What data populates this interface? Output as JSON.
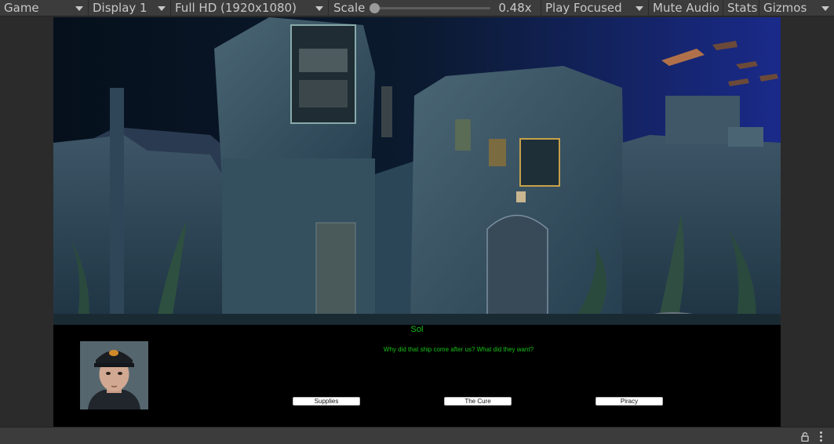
{
  "toolbar": {
    "view_label": "Game",
    "display_label": "Display 1",
    "resolution_label": "Full HD (1920x1080)",
    "scale_label": "Scale",
    "scale_value": "0.48x",
    "scale_fraction": 0.0,
    "play_mode_label": "Play Focused",
    "mute_label": "Mute Audio",
    "stats_label": "Stats",
    "gizmos_label": "Gizmos"
  },
  "dialog": {
    "speaker": "Sol",
    "line": "Why did that ship come after us? What did they want?",
    "choices": [
      "Supplies",
      "The Cure",
      "Piracy"
    ],
    "text_color": "#18c018"
  },
  "icons": {
    "lock": "lock-icon",
    "menu": "kebab-menu-icon",
    "dropdown": "caret-down-icon"
  }
}
